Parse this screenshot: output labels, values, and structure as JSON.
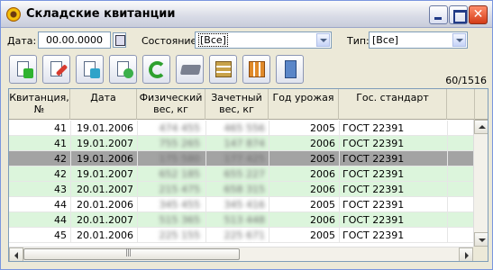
{
  "window": {
    "title": "Складские квитанции"
  },
  "filters": {
    "date_label": "Дата:",
    "date_value": "00.00.0000",
    "state_label": "Состояние:",
    "state_value": "[Все]",
    "type_label": "Тип:",
    "type_value": "[Все]"
  },
  "toolbar": {
    "buttons": [
      {
        "icon": "new-doc-icon"
      },
      {
        "icon": "edit-doc-icon"
      },
      {
        "icon": "export-doc-icon"
      },
      {
        "icon": "copy-doc-icon"
      },
      {
        "icon": "refresh-icon"
      },
      {
        "icon": "print-icon"
      },
      {
        "icon": "filter-icon"
      },
      {
        "icon": "transfer-icon"
      },
      {
        "icon": "exit-icon"
      }
    ],
    "counter": "60/1516"
  },
  "colors": {
    "row_green": "#dcf5dc",
    "row_selected": "#a3a3a3",
    "row_white": "#ffffff"
  },
  "table": {
    "headers": [
      "Квитанция, №",
      "Дата",
      "Физический вес, кг",
      "Зачетный вес, кг",
      "Год урожая",
      "Гос. стандарт"
    ],
    "rows": [
      {
        "num": "41",
        "date": "19.01.2006",
        "phys": "474 455",
        "credit": "465 556",
        "year": "2005",
        "std": "ГОСТ 22391",
        "style": "white"
      },
      {
        "num": "41",
        "date": "19.01.2007",
        "phys": "755 265",
        "credit": "147 874",
        "year": "2006",
        "std": "ГОСТ 22391",
        "style": "green"
      },
      {
        "num": "42",
        "date": "19.01.2006",
        "phys": "175 580",
        "credit": "177 425",
        "year": "2005",
        "std": "ГОСТ 22391",
        "style": "selected"
      },
      {
        "num": "42",
        "date": "19.01.2007",
        "phys": "652 185",
        "credit": "655 227",
        "year": "2006",
        "std": "ГОСТ 22391",
        "style": "green"
      },
      {
        "num": "43",
        "date": "20.01.2007",
        "phys": "215 475",
        "credit": "658 315",
        "year": "2006",
        "std": "ГОСТ 22391",
        "style": "green"
      },
      {
        "num": "44",
        "date": "20.01.2006",
        "phys": "345 455",
        "credit": "345 416",
        "year": "2005",
        "std": "ГОСТ 22391",
        "style": "white"
      },
      {
        "num": "44",
        "date": "20.01.2007",
        "phys": "515 365",
        "credit": "513 448",
        "year": "2006",
        "std": "ГОСТ 22391",
        "style": "green"
      },
      {
        "num": "45",
        "date": "20.01.2006",
        "phys": "225 155",
        "credit": "225 671",
        "year": "2005",
        "std": "ГОСТ 22391",
        "style": "white"
      }
    ]
  }
}
